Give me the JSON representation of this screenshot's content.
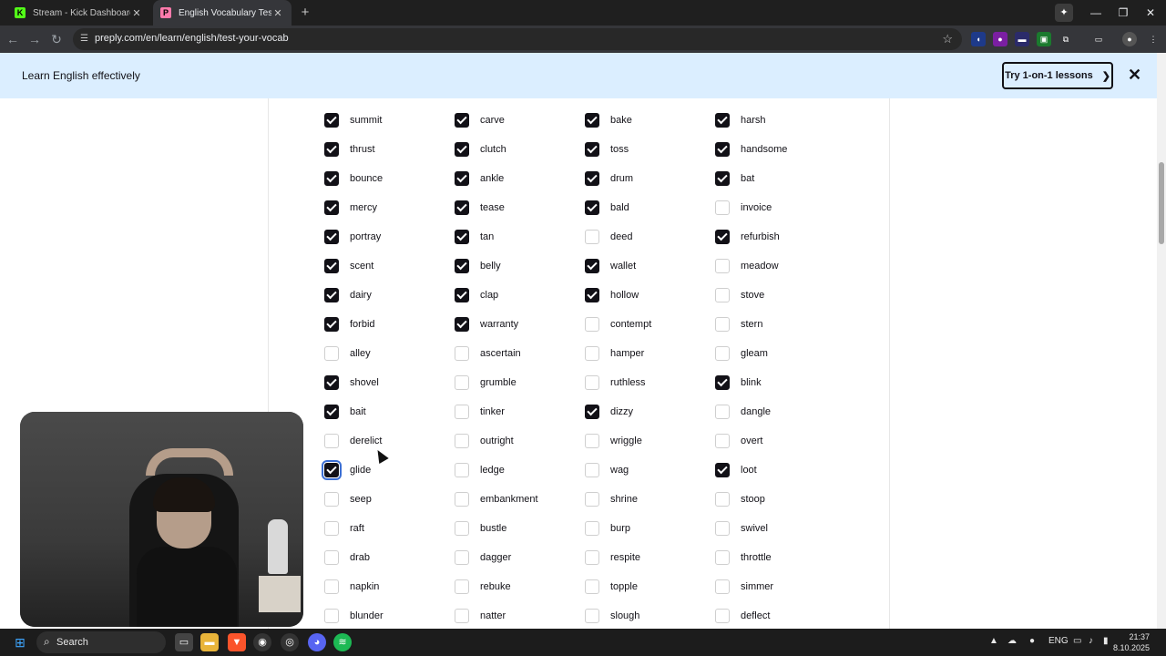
{
  "browser": {
    "tabs": [
      {
        "title": "Stream - Kick Dashboard",
        "favicon": "K",
        "color": "#53fc18",
        "active": false
      },
      {
        "title": "English Vocabulary Test: How M",
        "favicon": "P",
        "color": "#ff7aac",
        "active": true
      }
    ],
    "url": "preply.com/en/learn/english/test-your-vocab"
  },
  "banner": {
    "text": "Learn English effectively",
    "cta_label": "Try 1-on-1 lessons",
    "cta_arrow": "❯",
    "close": "✕"
  },
  "columns": [
    [
      {
        "word": "summit",
        "checked": true
      },
      {
        "word": "thrust",
        "checked": true
      },
      {
        "word": "bounce",
        "checked": true
      },
      {
        "word": "mercy",
        "checked": true
      },
      {
        "word": "portray",
        "checked": true
      },
      {
        "word": "scent",
        "checked": true
      },
      {
        "word": "dairy",
        "checked": true
      },
      {
        "word": "forbid",
        "checked": true
      },
      {
        "word": "alley",
        "checked": false
      },
      {
        "word": "shovel",
        "checked": true
      },
      {
        "word": "bait",
        "checked": true
      },
      {
        "word": "derelict",
        "checked": false
      },
      {
        "word": "glide",
        "checked": true,
        "focused": true
      },
      {
        "word": "seep",
        "checked": false
      },
      {
        "word": "raft",
        "checked": false
      },
      {
        "word": "drab",
        "checked": false
      },
      {
        "word": "napkin",
        "checked": false
      },
      {
        "word": "blunder",
        "checked": false
      }
    ],
    [
      {
        "word": "carve",
        "checked": true
      },
      {
        "word": "clutch",
        "checked": true
      },
      {
        "word": "ankle",
        "checked": true
      },
      {
        "word": "tease",
        "checked": true
      },
      {
        "word": "tan",
        "checked": true
      },
      {
        "word": "belly",
        "checked": true
      },
      {
        "word": "clap",
        "checked": true
      },
      {
        "word": "warranty",
        "checked": true
      },
      {
        "word": "ascertain",
        "checked": false
      },
      {
        "word": "grumble",
        "checked": false
      },
      {
        "word": "tinker",
        "checked": false
      },
      {
        "word": "outright",
        "checked": false
      },
      {
        "word": "ledge",
        "checked": false
      },
      {
        "word": "embankment",
        "checked": false
      },
      {
        "word": "bustle",
        "checked": false
      },
      {
        "word": "dagger",
        "checked": false
      },
      {
        "word": "rebuke",
        "checked": false
      },
      {
        "word": "natter",
        "checked": false
      }
    ],
    [
      {
        "word": "bake",
        "checked": true
      },
      {
        "word": "toss",
        "checked": true
      },
      {
        "word": "drum",
        "checked": true
      },
      {
        "word": "bald",
        "checked": true
      },
      {
        "word": "deed",
        "checked": false
      },
      {
        "word": "wallet",
        "checked": true
      },
      {
        "word": "hollow",
        "checked": true
      },
      {
        "word": "contempt",
        "checked": false
      },
      {
        "word": "hamper",
        "checked": false
      },
      {
        "word": "ruthless",
        "checked": false
      },
      {
        "word": "dizzy",
        "checked": true
      },
      {
        "word": "wriggle",
        "checked": false
      },
      {
        "word": "wag",
        "checked": false
      },
      {
        "word": "shrine",
        "checked": false
      },
      {
        "word": "burp",
        "checked": false
      },
      {
        "word": "respite",
        "checked": false
      },
      {
        "word": "topple",
        "checked": false
      },
      {
        "word": "slough",
        "checked": false
      }
    ],
    [
      {
        "word": "harsh",
        "checked": true
      },
      {
        "word": "handsome",
        "checked": true
      },
      {
        "word": "bat",
        "checked": true
      },
      {
        "word": "invoice",
        "checked": false
      },
      {
        "word": "refurbish",
        "checked": true
      },
      {
        "word": "meadow",
        "checked": false
      },
      {
        "word": "stove",
        "checked": false
      },
      {
        "word": "stern",
        "checked": false
      },
      {
        "word": "gleam",
        "checked": false
      },
      {
        "word": "blink",
        "checked": true
      },
      {
        "word": "dangle",
        "checked": false
      },
      {
        "word": "overt",
        "checked": false
      },
      {
        "word": "loot",
        "checked": true
      },
      {
        "word": "stoop",
        "checked": false
      },
      {
        "word": "swivel",
        "checked": false
      },
      {
        "word": "throttle",
        "checked": false
      },
      {
        "word": "simmer",
        "checked": false
      },
      {
        "word": "deflect",
        "checked": false
      }
    ]
  ],
  "taskbar": {
    "search_label": "Search",
    "lang": "ENG",
    "time": "21:37",
    "date": "8.10.2025"
  }
}
